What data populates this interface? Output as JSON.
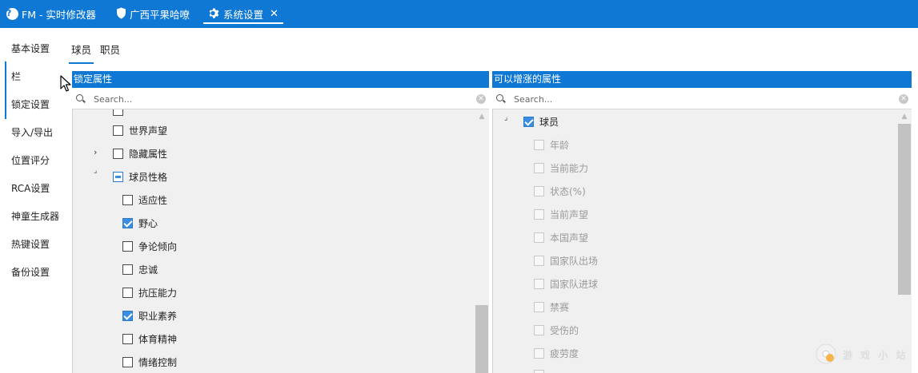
{
  "top_tabs": [
    {
      "label": "FM - 实时修改器",
      "icon": "help-icon"
    },
    {
      "label": "广西平果哈嘹",
      "icon": "shield-icon"
    },
    {
      "label": "系统设置",
      "icon": "gear-icon",
      "active": true,
      "close": "✕"
    }
  ],
  "left_nav": [
    {
      "label": "基本设置"
    },
    {
      "label": "栏",
      "active": true
    },
    {
      "label": "锁定设置",
      "active": true
    },
    {
      "label": "导入/导出"
    },
    {
      "label": "位置评分"
    },
    {
      "label": "RCA设置"
    },
    {
      "label": "神童生成器"
    },
    {
      "label": "热键设置"
    },
    {
      "label": "备份设置"
    }
  ],
  "sub_tabs": [
    {
      "label": "球员",
      "active": true
    },
    {
      "label": "职员"
    }
  ],
  "left_panel": {
    "header": "锁定属性",
    "search_placeholder": "Search...",
    "items": [
      {
        "label": "世界声望",
        "state": "unchecked"
      },
      {
        "label": "隐藏属性",
        "state": "unchecked",
        "expander": "collapsed"
      },
      {
        "label": "球员性格",
        "state": "partial",
        "expander": "expanded"
      },
      {
        "label": "适应性",
        "state": "unchecked"
      },
      {
        "label": "野心",
        "state": "checked"
      },
      {
        "label": "争论倾向",
        "state": "unchecked"
      },
      {
        "label": "忠诚",
        "state": "unchecked"
      },
      {
        "label": "抗压能力",
        "state": "unchecked"
      },
      {
        "label": "职业素养",
        "state": "checked"
      },
      {
        "label": "体育精神",
        "state": "unchecked"
      },
      {
        "label": "情绪控制",
        "state": "unchecked"
      }
    ]
  },
  "right_panel": {
    "header": "可以增涨的属性",
    "search_placeholder": "Search...",
    "root": {
      "label": "球员",
      "state": "checked",
      "expander": "expanded"
    },
    "items": [
      {
        "label": "年龄"
      },
      {
        "label": "当前能力"
      },
      {
        "label": "状态(%)"
      },
      {
        "label": "当前声望"
      },
      {
        "label": "本国声望"
      },
      {
        "label": "国家队出场"
      },
      {
        "label": "国家队进球"
      },
      {
        "label": "禁赛"
      },
      {
        "label": "受伤的"
      },
      {
        "label": "疲劳度"
      }
    ]
  },
  "watermark": "游 戏 小 站",
  "colors": {
    "accent": "#0f78d4",
    "tree_bg": "#f0f0f0",
    "check": "#3b8de0"
  }
}
